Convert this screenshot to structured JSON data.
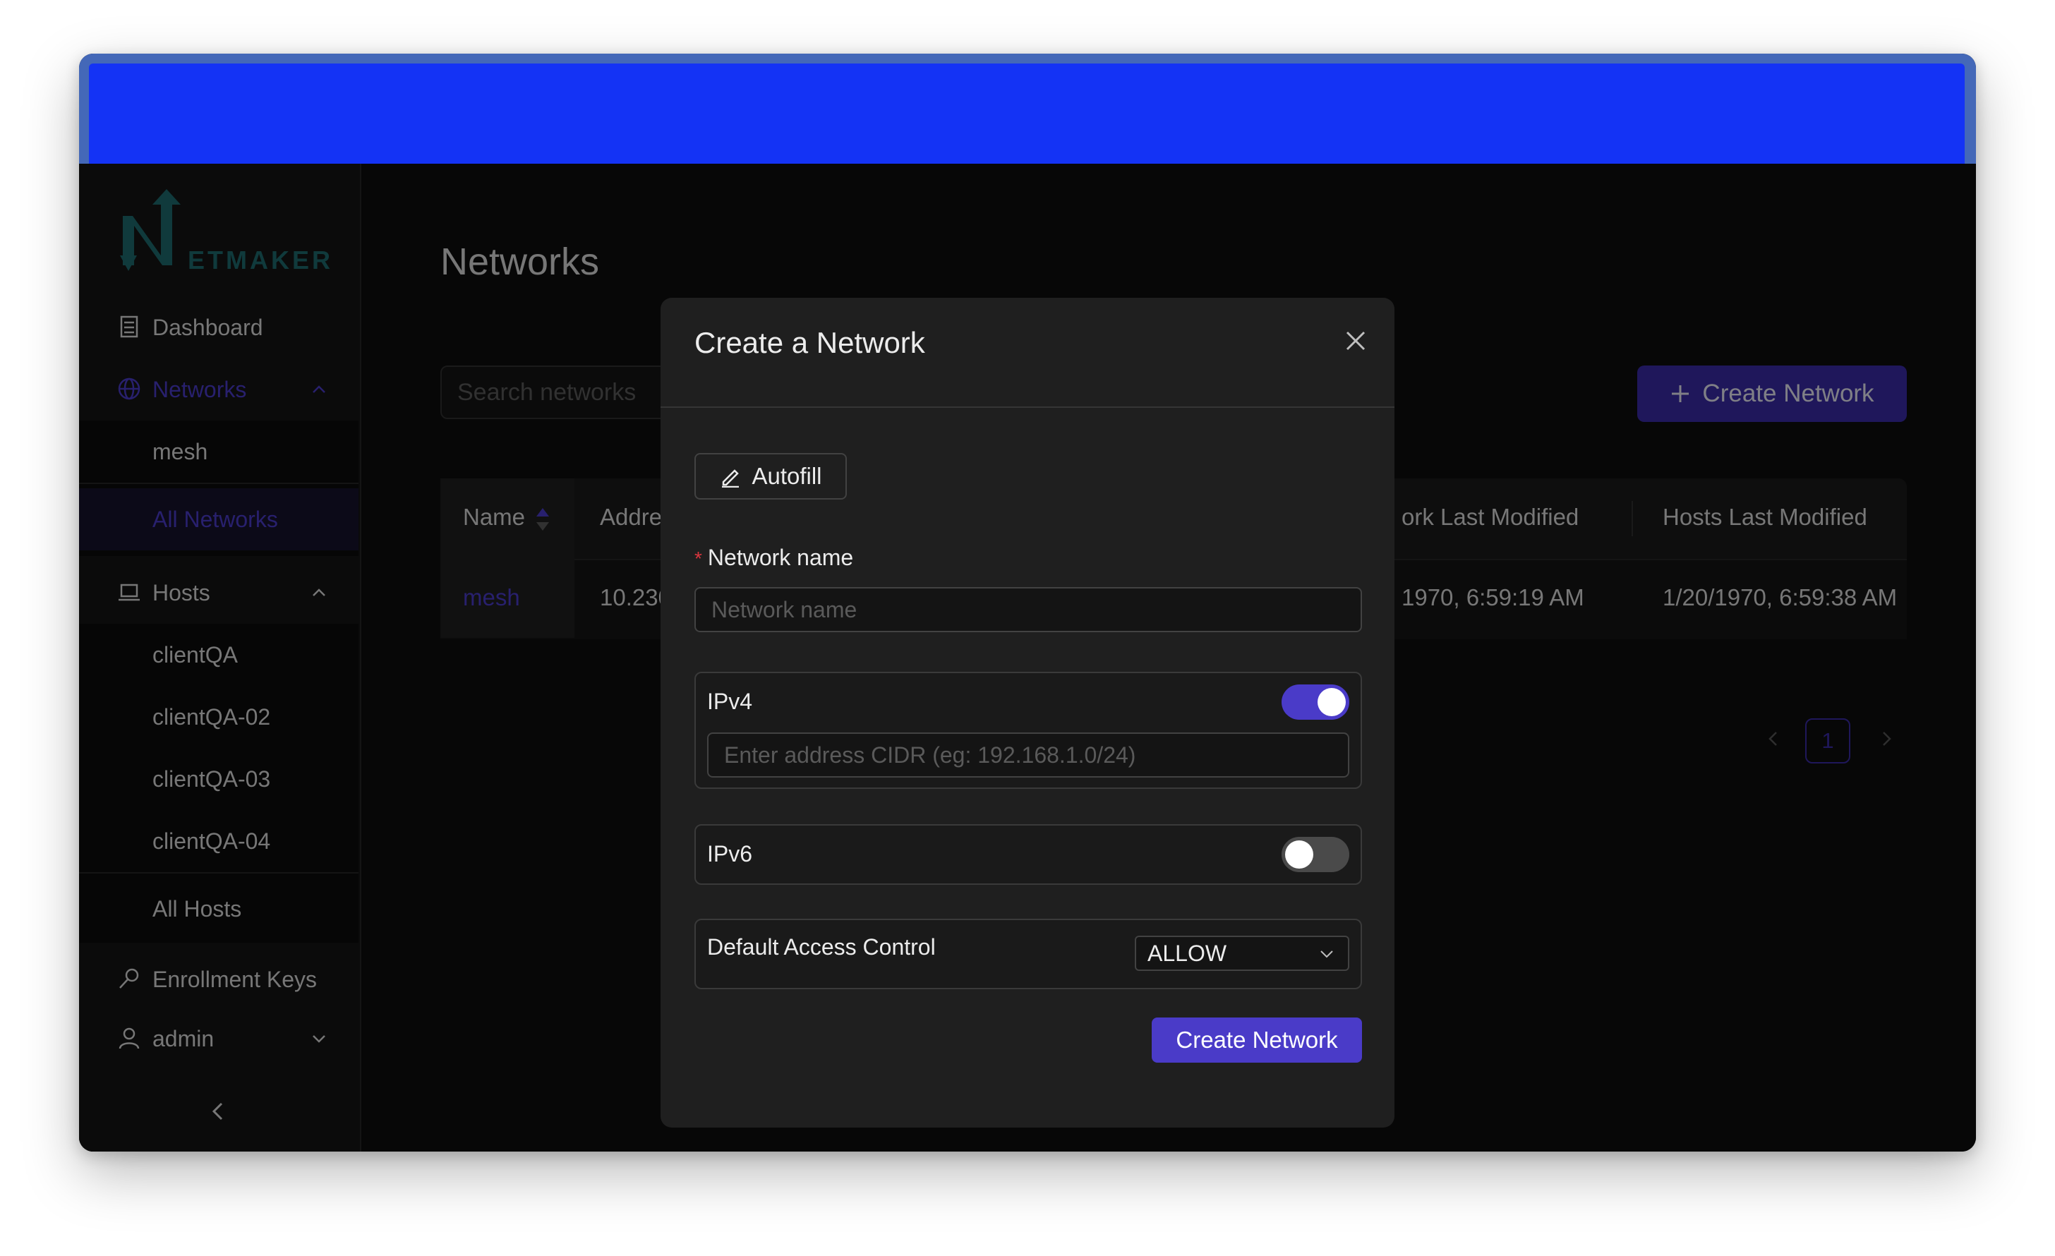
{
  "app": {
    "brand_suffix": "ETMAKER"
  },
  "sidebar": {
    "dashboard": "Dashboard",
    "networks": "Networks",
    "network_items": [
      "mesh"
    ],
    "all_networks": "All Networks",
    "hosts": "Hosts",
    "host_items": [
      "clientQA",
      "clientQA-02",
      "clientQA-03",
      "clientQA-04"
    ],
    "all_hosts": "All Hosts",
    "enrollment_keys": "Enrollment Keys",
    "user": "admin"
  },
  "main": {
    "title": "Networks",
    "search_placeholder": "Search networks",
    "create_button": "Create Network",
    "table": {
      "headers": [
        "Name",
        "Addres",
        "ork Last Modified",
        "Hosts Last Modified"
      ],
      "rows": [
        {
          "name": "mesh",
          "address": "10.230",
          "network_modified": "1970, 6:59:19 AM",
          "hosts_modified": "1/20/1970, 6:59:38 AM"
        }
      ]
    },
    "pagination": {
      "current": "1"
    }
  },
  "modal": {
    "title": "Create a Network",
    "autofill": "Autofill",
    "name_label": "Network name",
    "name_required_mark": "*",
    "name_placeholder": "Network name",
    "ipv4_label": "IPv4",
    "ipv4_enabled": true,
    "ipv4_placeholder": "Enter address CIDR (eg: 192.168.1.0/24)",
    "ipv6_label": "IPv6",
    "ipv6_enabled": false,
    "acl_label": "Default Access Control",
    "acl_value": "ALLOW",
    "submit": "Create Network"
  },
  "colors": {
    "accent": "#4a3bc8",
    "title_bar": "#1433f5",
    "background": "#0d0d0d",
    "panel": "#1f1f1f"
  },
  "icons": [
    "netmaker-logo-icon",
    "dashboard-icon",
    "globe-icon",
    "chevron-up-icon",
    "laptop-icon",
    "key-icon",
    "user-icon",
    "chevron-down-icon",
    "chevron-left-icon",
    "plus-icon",
    "sort-icon",
    "close-icon",
    "edit-icon"
  ]
}
